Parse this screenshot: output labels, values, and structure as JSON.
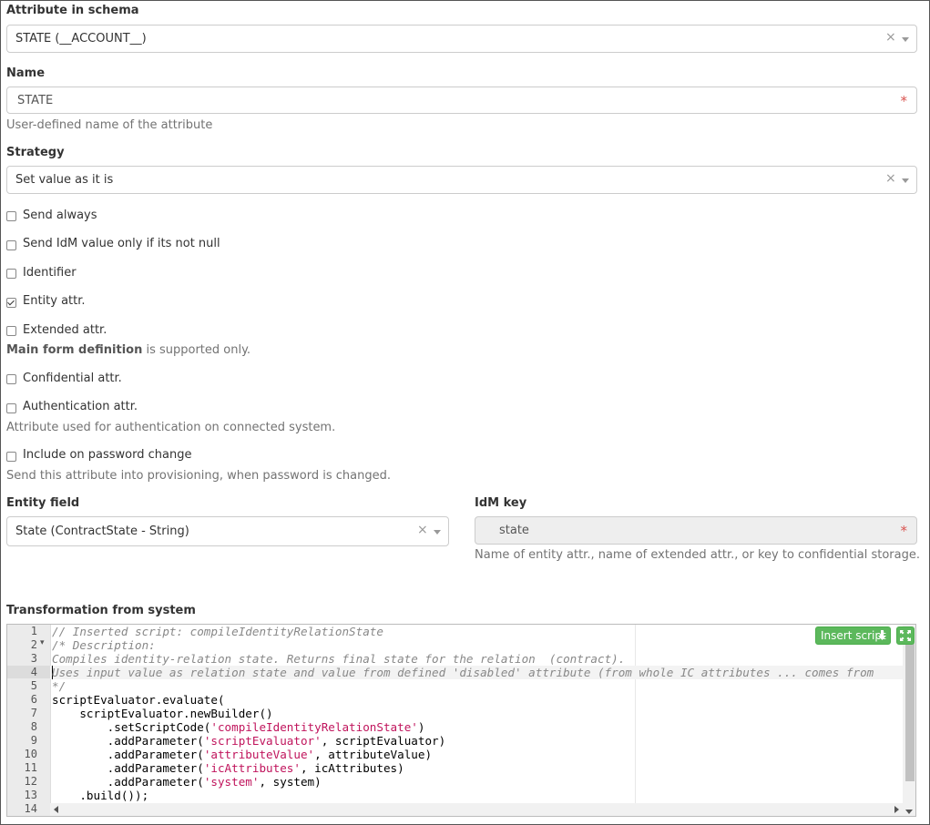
{
  "attribute_in_schema": {
    "label": "Attribute in schema",
    "value": "STATE (__ACCOUNT__)",
    "clear_symbol": "×"
  },
  "name": {
    "label": "Name",
    "value": "STATE",
    "required_mark": "*",
    "help": "User-defined name of the attribute"
  },
  "strategy": {
    "label": "Strategy",
    "value": "Set value as it is",
    "clear_symbol": "×"
  },
  "checkboxes": {
    "send_always": {
      "label": "Send always",
      "checked": false
    },
    "send_idm_value": {
      "label": "Send IdM value only if its not null",
      "checked": false
    },
    "identifier": {
      "label": "Identifier",
      "checked": false
    },
    "entity_attr": {
      "label": "Entity attr.",
      "checked": true
    },
    "extended_attr": {
      "label": "Extended attr.",
      "checked": false
    },
    "confidential_attr": {
      "label": "Confidential attr.",
      "checked": false
    },
    "authentication_attr": {
      "label": "Authentication attr.",
      "checked": false
    },
    "include_password": {
      "label": "Include on password change",
      "checked": false
    }
  },
  "extended_help": {
    "bold": "Main form definition",
    "rest": " is supported only."
  },
  "authentication_help": "Attribute used for authentication on connected system.",
  "password_help": "Send this attribute into provisioning, when password is changed.",
  "entity_field": {
    "label": "Entity field",
    "value": "State (ContractState - String)",
    "clear_symbol": "×"
  },
  "idm_key": {
    "label": "IdM key",
    "value": "state",
    "required_mark": "*",
    "help": "Name of entity attr., name of extended attr., or key to confidential storage."
  },
  "transformation": {
    "label": "Transformation from system",
    "insert_button": "Insert script",
    "line_numbers": [
      "1",
      "2",
      "3",
      "4",
      "5",
      "6",
      "7",
      "8",
      "9",
      "10",
      "11",
      "12",
      "13",
      "14"
    ],
    "fold_marker": "▾"
  },
  "colors": {
    "accent_green": "#5cb85c",
    "required_red": "#d9534f",
    "string_color": "#c0145c",
    "comment_color": "#888888"
  }
}
